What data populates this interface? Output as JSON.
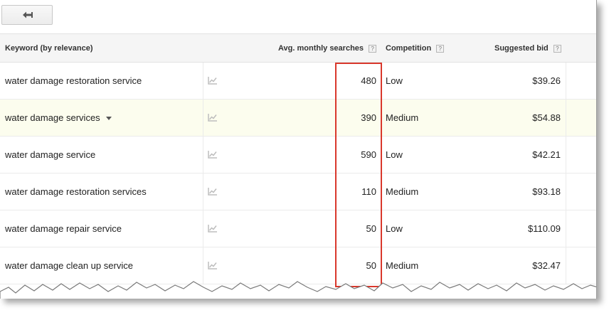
{
  "toolbar": {
    "back_icon": "back-arrow-icon"
  },
  "table": {
    "headers": {
      "keyword": "Keyword (by relevance)",
      "searches": "Avg. monthly searches",
      "competition": "Competition",
      "bid": "Suggested bid",
      "help_glyph": "?"
    },
    "rows": [
      {
        "keyword": "water damage restoration service",
        "searches": "480",
        "competition": "Low",
        "bid": "$39.26"
      },
      {
        "keyword": "water damage services",
        "searches": "390",
        "competition": "Medium",
        "bid": "$54.88"
      },
      {
        "keyword": "water damage service",
        "searches": "590",
        "competition": "Low",
        "bid": "$42.21"
      },
      {
        "keyword": "water damage restoration services",
        "searches": "110",
        "competition": "Medium",
        "bid": "$93.18"
      },
      {
        "keyword": "water damage repair service",
        "searches": "50",
        "competition": "Low",
        "bid": "$110.09"
      },
      {
        "keyword": "water damage clean up service",
        "searches": "50",
        "competition": "Medium",
        "bid": "$32.47"
      }
    ]
  },
  "colors": {
    "highlight_row": "#fcfdee",
    "annotation_box": "#d9382c"
  }
}
